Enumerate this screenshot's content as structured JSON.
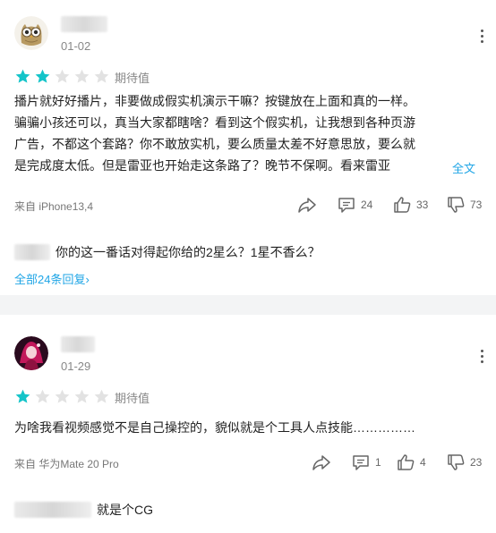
{
  "reviews": [
    {
      "date": "01-02",
      "rating": 2,
      "rating_label": "期待值",
      "body_lines": [
        "播片就好好播片，非要做成假实机演示干嘛？按键放在上面和真的一样。",
        "骗骗小孩还可以，真当大家都瞎啥？看到这个假实机，让我想到各种页游",
        "广告，不都这个套路？你不敢放实机，要么质量太差不好意思放，要么就",
        "是完成度太低。但是雷亚也开始走这条路了？晚节不保啊。看来雷亚"
      ],
      "expand_label": "全文",
      "device": "来自 iPhone13,4",
      "actions": {
        "share": "",
        "comments": "24",
        "likes": "33",
        "dislikes": "73"
      },
      "reply_text": "你的这一番话对得起你给的2星么？1星不香么？",
      "all_replies_label": "全部24条回复"
    },
    {
      "date": "01-29",
      "rating": 1,
      "rating_label": "期待值",
      "body_lines": [
        "为啥我看视频感觉不是自己操控的，貌似就是个工具人点技能……………"
      ],
      "device": "来自 华为Mate 20 Pro",
      "actions": {
        "share": "",
        "comments": "1",
        "likes": "4",
        "dislikes": "23"
      },
      "reply_text": "就是个CG"
    }
  ],
  "colors": {
    "star_on": "#14c4c9",
    "star_off": "#e2e2e2",
    "link": "#1fa5e6",
    "gap": "#f3f4f5"
  },
  "icons": [
    "owl-avatar",
    "anime-avatar",
    "more-icon",
    "star-icon",
    "share-icon",
    "comment-icon",
    "thumb-up-icon",
    "thumb-down-icon"
  ]
}
